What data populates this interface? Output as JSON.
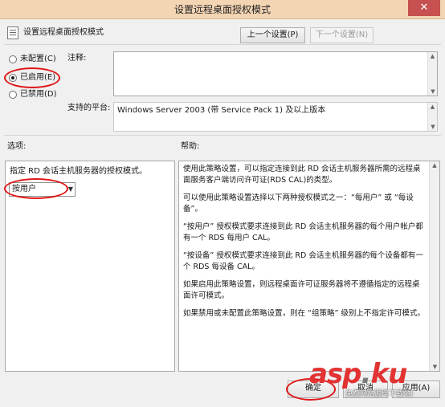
{
  "window": {
    "title": "设置远程桌面授权模式",
    "close_glyph": "✕"
  },
  "header": {
    "policy_name": "设置远程桌面授权模式",
    "prev_button": "上一个设置(P)",
    "next_button": "下一个设置(N)"
  },
  "state": {
    "options": [
      "未配置(C)",
      "已启用(E)",
      "已禁用(D)"
    ],
    "selected": "已启用(E)"
  },
  "comment": {
    "label": "注释:",
    "value": ""
  },
  "platform": {
    "label": "支持的平台:",
    "value": "Windows Server 2003 (带 Service Pack 1) 及以上版本"
  },
  "options_section": {
    "label": "选项:",
    "description": "指定 RD 会话主机服务器的授权模式。",
    "dropdown_value": "按用户"
  },
  "help_section": {
    "label": "帮助:",
    "paragraphs": [
      "使用此策略设置，可以指定连接到此 RD 会话主机服务器所需的远程桌面服务客户端访问许可证(RDS CAL)的类型。",
      "可以使用此策略设置选择以下两种授权模式之一：“每用户” 或 “每设备”。",
      "“按用户” 授权模式要求连接到此 RD 会话主机服务器的每个用户帐户都有一个 RDS 每用户 CAL。",
      "“按设备” 授权模式要求连接到此 RD 会话主机服务器的每个设备都有一个 RDS 每设备 CAL。",
      "如果启用此策略设置，则远程桌面许可证服务器将不遵循指定的远程桌面许可模式。",
      "如果禁用或未配置此策略设置，则在 “组策略” 级别上不指定许可模式。"
    ]
  },
  "footer": {
    "ok_button": "确定",
    "cancel_button": "取消",
    "apply_button": "应用(A)"
  },
  "watermark": {
    "logo_main": "asp",
    "logo_dot": ".",
    "logo_tail": "ku",
    "tagline": "免费网站源码下载站!"
  },
  "colors": {
    "titlebar": "#f4d5b3",
    "close_button": "#c75050",
    "annotation_red": "#e01818",
    "watermark_red": "#e23232"
  }
}
